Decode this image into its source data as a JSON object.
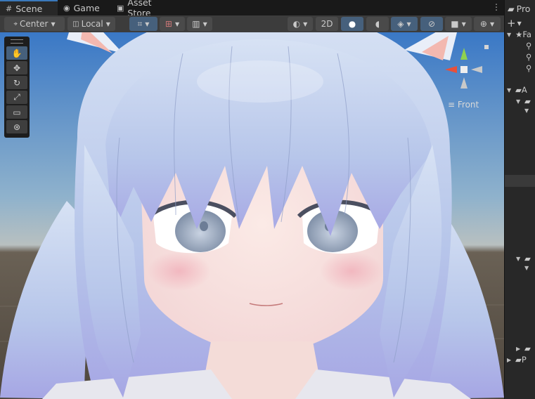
{
  "tabs": [
    {
      "label": "Scene",
      "icon": "hash-grid-icon",
      "active": true
    },
    {
      "label": "Game",
      "icon": "gamepad-icon",
      "active": false
    },
    {
      "label": "Asset Store",
      "icon": "shopping-bag-icon",
      "active": false
    }
  ],
  "toolbar": {
    "pivot_mode": "Center",
    "pivot_rotation": "Local",
    "mode_2d": "2D"
  },
  "tools": [
    "hand-tool",
    "move-tool",
    "rotate-tool",
    "scale-tool",
    "rect-tool",
    "transform-tool"
  ],
  "gizmo": {
    "view_label": "Front"
  },
  "project_panel": {
    "tab_label": "Pro",
    "add_label": "+",
    "favorites_label": "Fa",
    "assets_label": "A",
    "packages_label": "P"
  },
  "colors": {
    "sky_top": "#3a78c6",
    "ground": "#5c5449",
    "accent": "#3a79bb",
    "gizmo_x": "#e8503a",
    "gizmo_y": "#8fd14f"
  }
}
